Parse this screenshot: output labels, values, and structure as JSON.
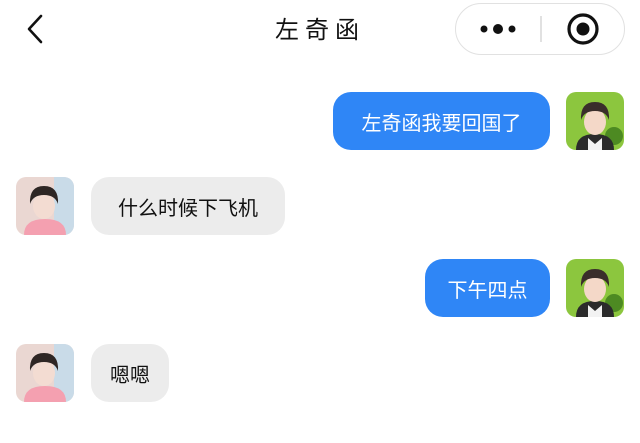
{
  "header": {
    "title": "左奇函",
    "back_icon": "chevron-left-icon",
    "more_icon": "more-dots-icon",
    "close_icon": "target-circle-icon"
  },
  "messages": [
    {
      "side": "sent",
      "text": "左奇函我要回国了"
    },
    {
      "side": "received",
      "text": "什么时候下飞机"
    },
    {
      "side": "sent",
      "text": "下午四点"
    },
    {
      "side": "received",
      "text": "嗯嗯"
    }
  ],
  "colors": {
    "sent_bubble": "#2f86f6",
    "received_bubble": "#ececec",
    "sent_avatar_bg": "#8cc63e",
    "received_avatar_bg": "#ead7d2"
  }
}
